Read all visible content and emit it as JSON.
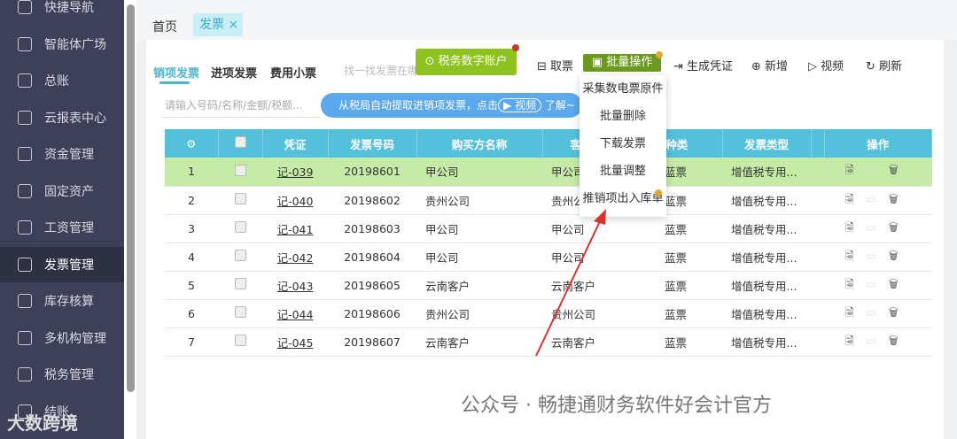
{
  "sidebar": {
    "items": [
      {
        "label": "快捷导航"
      },
      {
        "label": "智能体广场"
      },
      {
        "label": "总账"
      },
      {
        "label": "云报表中心"
      },
      {
        "label": "资金管理"
      },
      {
        "label": "固定资产"
      },
      {
        "label": "工资管理"
      },
      {
        "label": "发票管理"
      },
      {
        "label": "库存核算"
      },
      {
        "label": "多机构管理"
      },
      {
        "label": "税务管理"
      },
      {
        "label": "结账"
      }
    ]
  },
  "tabs": {
    "home": "首页",
    "invoice": "发票 ×"
  },
  "subtabs": [
    "销项发票",
    "进项发票",
    "费用小票"
  ],
  "find_text": "找一找发票在哪",
  "tax_button": "税务数字账户",
  "toolbar": {
    "fetch": "取票",
    "bulk": "批量操作",
    "voucher": "生成凭证",
    "add": "新增",
    "video": "视频",
    "refresh": "刷新"
  },
  "search": {
    "placeholder": "请输入号码/名称/金额/税额..."
  },
  "tip": {
    "text": "从税局自动提取进销项发票，点击",
    "video": "视频",
    "more": "了解~"
  },
  "dropdown": [
    "采集数电票原件",
    "批量删除",
    "下载发票",
    "批量调整",
    "推销项出入库单"
  ],
  "table": {
    "headers": [
      "",
      "凭证",
      "发票号码",
      "购买方名称",
      "客户",
      "票种类",
      "发票类型",
      "",
      "操作"
    ],
    "rows": [
      [
        "1",
        "记-039",
        "20198601",
        "甲公司",
        "甲公司",
        "蓝票",
        "增值税专用..."
      ],
      [
        "2",
        "记-040",
        "20198602",
        "贵州公司",
        "贵州公司",
        "蓝票",
        "增值税专用..."
      ],
      [
        "3",
        "记-041",
        "20198603",
        "甲公司",
        "甲公司",
        "蓝票",
        "增值税专用..."
      ],
      [
        "4",
        "记-042",
        "20198604",
        "甲公司",
        "甲公司",
        "蓝票",
        "增值税专用..."
      ],
      [
        "5",
        "记-043",
        "20198605",
        "云南客户",
        "云南客户",
        "蓝票",
        "增值税专用..."
      ],
      [
        "6",
        "记-044",
        "20198606",
        "贵州公司",
        "贵州公司",
        "蓝票",
        "增值税专用..."
      ],
      [
        "7",
        "记-045",
        "20198607",
        "云南客户",
        "云南客户",
        "蓝票",
        "增值税专用..."
      ]
    ]
  },
  "watermark": "公众号 · 畅捷通财务软件好会计官方",
  "watermark2": "大数跨境"
}
